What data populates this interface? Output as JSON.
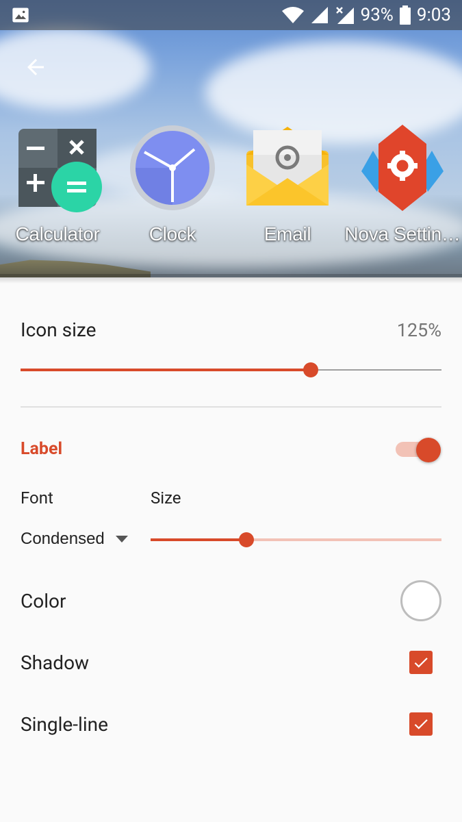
{
  "status_bar": {
    "battery": "93%",
    "time": "9:03",
    "icons": [
      "gallery-icon",
      "wifi-icon",
      "signal-icon",
      "signal-off-icon",
      "battery-icon"
    ]
  },
  "header": {
    "back_icon": "arrow-back-icon",
    "apps": [
      {
        "label": "Calculator",
        "icon": "calculator-icon"
      },
      {
        "label": "Clock",
        "icon": "clock-icon"
      },
      {
        "label": "Email",
        "icon": "email-icon"
      },
      {
        "label": "Nova Settin…",
        "icon": "nova-settings-icon"
      }
    ]
  },
  "icon_size": {
    "title": "Icon size",
    "value": "125%",
    "slider_fraction": 0.69
  },
  "label_section": {
    "title": "Label",
    "enabled": true,
    "font": {
      "title": "Font",
      "value": "Condensed"
    },
    "size": {
      "title": "Size",
      "slider_fraction": 0.33
    }
  },
  "prefs": {
    "color": {
      "title": "Color"
    },
    "shadow": {
      "title": "Shadow",
      "checked": true
    },
    "single_line": {
      "title": "Single-line",
      "checked": true
    }
  },
  "colors": {
    "accent": "#d84a2a",
    "accent_light": "#f2c2b6"
  }
}
